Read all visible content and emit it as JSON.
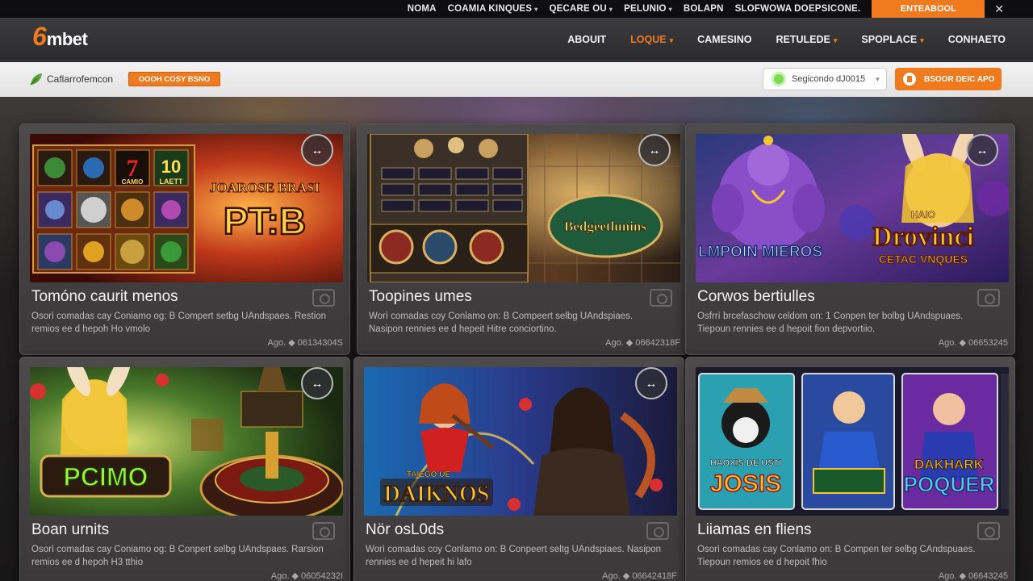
{
  "topbar": {
    "links": [
      {
        "label": "NOMA",
        "caret": false
      },
      {
        "label": "COAMIA KINQUES",
        "caret": true
      },
      {
        "label": "QECARE OU",
        "caret": true
      },
      {
        "label": "PELUNIO",
        "caret": true
      },
      {
        "label": "BOLAPN",
        "caret": false
      },
      {
        "label": "SLOFWOWA DOEPSICONE.",
        "caret": false
      }
    ],
    "enter_label": "ENTEABOOL",
    "close_symbol": "✕"
  },
  "header": {
    "logo_mark": "6",
    "logo_text": "mbet",
    "nav": [
      {
        "label": "ABOUIT",
        "caret": false,
        "active": false
      },
      {
        "label": "LOQUE",
        "caret": true,
        "active": true
      },
      {
        "label": "CAMESINO",
        "caret": false,
        "active": false
      },
      {
        "label": "RETULEDE",
        "caret": true,
        "active": false
      },
      {
        "label": "SPOPLACE",
        "caret": true,
        "active": false
      },
      {
        "label": "CONHAETO",
        "caret": false,
        "active": false
      }
    ]
  },
  "subbar": {
    "brand_text": "Caflarrofemcon",
    "promo_label": "OOOH COSY BSNO",
    "search_text": "Segicondo dJ0015",
    "app_label": "BSOOR DEIC APO"
  },
  "cards": [
    {
      "title": "Tomóno caurit menos",
      "desc": "Osorì comadas cay Coniamo og: B Compert setbg UAndspaes. Restion remios ee d hepoh Ho vmolo",
      "meta": "Ago. ◆ 06134304S",
      "expand": "↔"
    },
    {
      "title": "Toopines umes",
      "desc": "Worì comadas coy Conlamo on: B Compeert selbg UAndspiaes. Nasipon rennies ee d hepeit Hitre conciortino.",
      "meta": "Ago. ◆ 06642318F",
      "expand": "↔"
    },
    {
      "title": "Corwos bertiulles",
      "desc": "Osfrrì brcefaschow celdom on: 1 Conpen ter bolbg UAndspuaes. Tiepoun rennies ee d hepoit fion depvortiio.",
      "meta": "Ago. ◆ 06653245",
      "expand": "↔"
    },
    {
      "title": "Boan urnits",
      "desc": "Osorì comadas cay Coniamo og: B Conpert selbg UAndspaes. Rarsion remios ee d hepoh H3 tthio",
      "meta": "Ago. ◆ 06054232I",
      "expand": "↔"
    },
    {
      "title": "Nör osL0ds",
      "desc": "Worì comadas coy Conlamo on: B Conpeert seltg UAndspiaes. Nasipon rennies ee d hepeit hi lafo",
      "meta": "Ago. ◆ 06642418F",
      "expand": "↔"
    },
    {
      "title": "Liiamas en fliens",
      "desc": "Osorì comadas cay Conlamo on: B Compen ter selbg CAndspuaes. Tiepoun remios ee d hepoit fhio",
      "meta": "Ago. ◆ 06643245",
      "expand": ""
    }
  ],
  "artwork": {
    "card1_big": "PT:B",
    "card1_sub": "JOAROSE BRASI",
    "card1_tiles": [
      "7",
      "10"
    ],
    "card1_tile_captions": [
      "CAMIO",
      "LAETT"
    ],
    "card2_logo": "Bedgeetlunins",
    "card3_left": "LMPOIN MIEROS",
    "card3_right_top": "HAIO",
    "card3_right": "Drovinci",
    "card3_right_sub": "CETAC VNQUES",
    "card4_logo": "PCIMO",
    "card5_top": "TAIEGO UE",
    "card5_logo": "DAIKNOS",
    "card6_tiles": [
      "HAOXIS DE USTI",
      "JOSIS",
      "DAKHARK",
      "POQUER"
    ],
    "colors": {
      "accent": "#f07a1e",
      "gold": "#f3c531",
      "purple": "#8a4fc8"
    }
  }
}
